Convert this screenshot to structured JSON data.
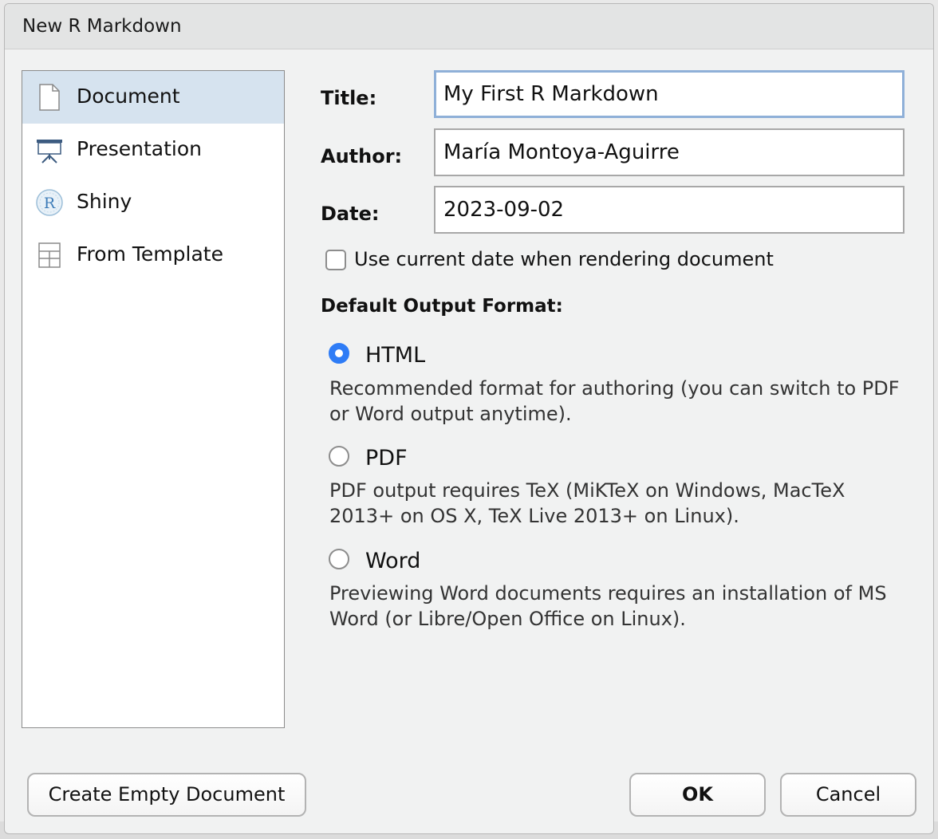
{
  "dialog": {
    "title": "New R Markdown"
  },
  "sidebar": {
    "items": [
      {
        "label": "Document",
        "icon": "document-icon",
        "selected": true
      },
      {
        "label": "Presentation",
        "icon": "presentation-icon",
        "selected": false
      },
      {
        "label": "Shiny",
        "icon": "shiny-r-icon",
        "selected": false
      },
      {
        "label": "From Template",
        "icon": "template-icon",
        "selected": false
      }
    ]
  },
  "form": {
    "title_label": "Title:",
    "title_value": "My First R Markdown",
    "author_label": "Author:",
    "author_value": "María Montoya-Aguirre",
    "date_label": "Date:",
    "date_value": "2023-09-02",
    "use_current_date_label": "Use current date when rendering document",
    "use_current_date_checked": false
  },
  "output_format": {
    "heading": "Default Output Format:",
    "selected": "HTML",
    "options": [
      {
        "label": "HTML",
        "description": "Recommended format for authoring (you can switch to PDF or Word output anytime)."
      },
      {
        "label": "PDF",
        "description": "PDF output requires TeX (MiKTeX on Windows, MacTeX 2013+ on OS X, TeX Live 2013+ on Linux)."
      },
      {
        "label": "Word",
        "description": "Previewing Word documents requires an installation of MS Word (or Libre/Open Office on Linux)."
      }
    ]
  },
  "buttons": {
    "create_empty": "Create Empty Document",
    "ok": "OK",
    "cancel": "Cancel"
  },
  "colors": {
    "selected_bg": "#d6e3ef",
    "radio_accent": "#2e7cf6",
    "focus_border": "#8fb0d8"
  }
}
